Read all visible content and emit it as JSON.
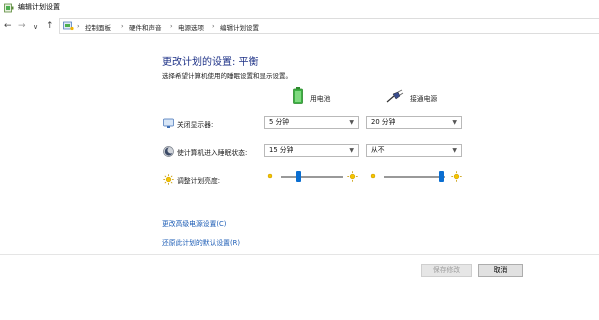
{
  "window": {
    "title": "编辑计划设置"
  },
  "nav": {
    "back": "←",
    "forward": "→",
    "recent": "∨",
    "up": "↑",
    "breadcrumbs": [
      "控制面板",
      "硬件和声音",
      "电源选项",
      "编辑计划设置"
    ],
    "separator": "›"
  },
  "main": {
    "heading": "更改计划的设置: 平衡",
    "subtitle": "选择希望计算机使用的睡眠设置和显示设置。",
    "columns": {
      "battery": "用电池",
      "plugged": "接通电源"
    },
    "rows": [
      {
        "label": "关闭显示器:",
        "battery_value": "5 分钟",
        "plugged_value": "20 分钟"
      },
      {
        "label": "使计算机进入睡眠状态:",
        "battery_value": "15 分钟",
        "plugged_value": "从不"
      },
      {
        "label": "调整计划亮度:",
        "battery_level": 0.4,
        "plugged_level": 1.0
      }
    ],
    "links": {
      "advanced": "更改高级电源设置(C)",
      "restore": "还原此计划的默认设置(R)"
    }
  },
  "footer": {
    "save": "保存修改",
    "cancel": "取消"
  },
  "colors": {
    "heading": "#1e3287",
    "link": "#1a5bb5",
    "slider": "#0a6ed1"
  }
}
